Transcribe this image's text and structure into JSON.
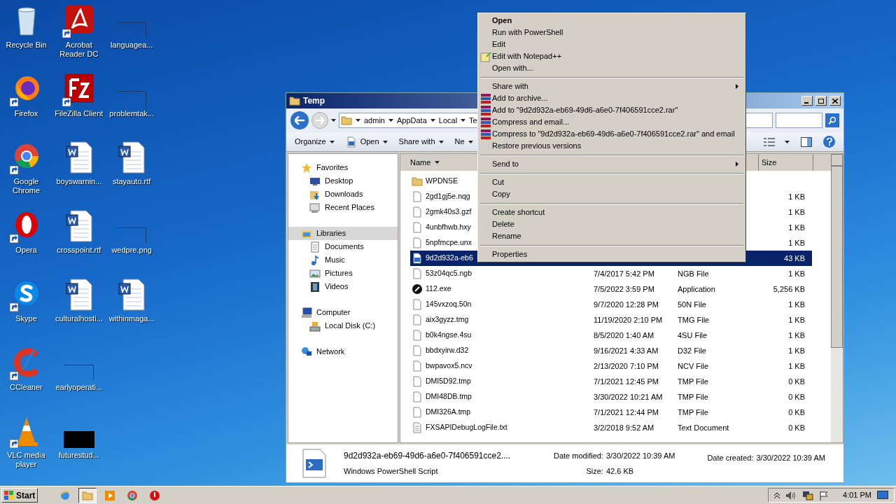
{
  "desktop_icons": [
    {
      "label": "Recycle Bin",
      "kind": "trash",
      "shortcut": false
    },
    {
      "label": "Firefox",
      "kind": "firefox",
      "shortcut": true
    },
    {
      "label": "Google Chrome",
      "kind": "chrome",
      "shortcut": true
    },
    {
      "label": "Opera",
      "kind": "opera",
      "shortcut": true
    },
    {
      "label": "Skype",
      "kind": "skype",
      "shortcut": true
    },
    {
      "label": "CCleaner",
      "kind": "ccleaner",
      "shortcut": true
    },
    {
      "label": "VLC media player",
      "kind": "vlc",
      "shortcut": true
    },
    {
      "label": "Acrobat Reader DC",
      "kind": "acrobat",
      "shortcut": true
    },
    {
      "label": "FileZilla Client",
      "kind": "filezilla",
      "shortcut": true
    },
    {
      "label": "boyswarnin...",
      "kind": "word",
      "shortcut": false
    },
    {
      "label": "crosspoint.rtf",
      "kind": "word",
      "shortcut": false
    },
    {
      "label": "culturalhosti...",
      "kind": "word",
      "shortcut": false
    },
    {
      "label": "earlyoperati...",
      "kind": "blank",
      "shortcut": false
    },
    {
      "label": "futurestud...",
      "kind": "black",
      "shortcut": false
    },
    {
      "label": "languagea...",
      "kind": "blank",
      "shortcut": false
    },
    {
      "label": "problemtak...",
      "kind": "blank",
      "shortcut": false
    },
    {
      "label": "stayauto.rtf",
      "kind": "word",
      "shortcut": false
    },
    {
      "label": "wedpre.png",
      "kind": "blank",
      "shortcut": false
    },
    {
      "label": "withinmaga...",
      "kind": "word",
      "shortcut": false
    }
  ],
  "window": {
    "title": "Temp",
    "breadcrumb": [
      "admin",
      "AppData",
      "Local",
      "Te"
    ],
    "toolbar": [
      {
        "label": "Organize",
        "icon": false
      },
      {
        "label": "Open",
        "icon": true
      },
      {
        "label": "Share with",
        "icon": false
      },
      {
        "label": "Ne",
        "icon": false
      }
    ],
    "nav": [
      {
        "label": "Favorites",
        "kind": "star",
        "selected": false,
        "children": [
          {
            "label": "Desktop",
            "kind": "desktop",
            "selected": false
          },
          {
            "label": "Downloads",
            "kind": "downloads",
            "selected": false
          },
          {
            "label": "Recent Places",
            "kind": "recent",
            "selected": false
          }
        ]
      },
      {
        "label": "Libraries",
        "kind": "library",
        "selected": true,
        "children": [
          {
            "label": "Documents",
            "kind": "documents",
            "selected": false
          },
          {
            "label": "Music",
            "kind": "music",
            "selected": false
          },
          {
            "label": "Pictures",
            "kind": "pictures",
            "selected": false
          },
          {
            "label": "Videos",
            "kind": "videos",
            "selected": false
          }
        ]
      },
      {
        "label": "Computer",
        "kind": "computer",
        "selected": false,
        "children": [
          {
            "label": "Local Disk (C:)",
            "kind": "disk",
            "selected": false
          }
        ]
      },
      {
        "label": "Network",
        "kind": "network",
        "selected": false
      }
    ],
    "columns": {
      "name": "Name",
      "size": "Size"
    },
    "rows": [
      {
        "name": "WPDNSE",
        "kind": "folder",
        "selected": false
      },
      {
        "name": "2gd1gj5e.nqg",
        "kind": "file",
        "size": "1 KB",
        "selected": false
      },
      {
        "name": "2gmk40s3.gzf",
        "kind": "file",
        "size": "1 KB",
        "selected": false
      },
      {
        "name": "4unbfhwb.hxy",
        "kind": "file",
        "size": "1 KB",
        "selected": false
      },
      {
        "name": "5npfmcpe.unx",
        "kind": "file",
        "size": "1 KB",
        "selected": false
      },
      {
        "name": "9d2d932a-eb6",
        "kind": "script",
        "size": "43 KB",
        "selected": true
      },
      {
        "name": "53z04qc5.ngb",
        "kind": "file",
        "date": "7/4/2017 5:42 PM",
        "type": "NGB File",
        "size": "1 KB",
        "selected": false
      },
      {
        "name": "112.exe",
        "kind": "exe",
        "date": "7/5/2022 3:59 PM",
        "type": "Application",
        "size": "5,256 KB",
        "selected": false
      },
      {
        "name": "145vxzoq.50n",
        "kind": "file",
        "date": "9/7/2020 12:28 PM",
        "type": "50N File",
        "size": "1 KB",
        "selected": false
      },
      {
        "name": "aix3gyzz.tmg",
        "kind": "file",
        "date": "11/19/2020 2:10 PM",
        "type": "TMG File",
        "size": "1 KB",
        "selected": false
      },
      {
        "name": "b0k4ngse.4su",
        "kind": "file",
        "date": "8/5/2020 1:40 AM",
        "type": "4SU File",
        "size": "1 KB",
        "selected": false
      },
      {
        "name": "bbdxyirw.d32",
        "kind": "file",
        "date": "9/16/2021 4:33 AM",
        "type": "D32 File",
        "size": "1 KB",
        "selected": false
      },
      {
        "name": "bwpavox5.ncv",
        "kind": "file",
        "date": "2/13/2020 7:10 PM",
        "type": "NCV File",
        "size": "1 KB",
        "selected": false
      },
      {
        "name": "DMI5D92.tmp",
        "kind": "file",
        "date": "7/1/2021 12:45 PM",
        "type": "TMP File",
        "size": "0 KB",
        "selected": false
      },
      {
        "name": "DMI48DB.tmp",
        "kind": "file",
        "date": "3/30/2022 10:21 AM",
        "type": "TMP File",
        "size": "0 KB",
        "selected": false
      },
      {
        "name": "DMI326A.tmp",
        "kind": "file",
        "date": "7/1/2021 12:44 PM",
        "type": "TMP File",
        "size": "0 KB",
        "selected": false
      },
      {
        "name": "FXSAPIDebugLogFile.txt",
        "kind": "text",
        "date": "3/2/2018 9:52 AM",
        "type": "Text Document",
        "size": "0 KB",
        "selected": false
      }
    ],
    "details": {
      "name": "9d2d932a-eb69-49d6-a6e0-7f406591cce2....",
      "type": "Windows PowerShell Script",
      "modified_label": "Date modified:",
      "modified": "3/30/2022 10:39 AM",
      "size_label": "Size:",
      "size": "42.6 KB",
      "created_label": "Date created:",
      "created": "3/30/2022 10:39 AM"
    }
  },
  "context_menu": [
    {
      "kind": "plain",
      "label": "Open",
      "bold": true,
      "submenu": false
    },
    {
      "kind": "plain",
      "label": "Run with PowerShell",
      "bold": false,
      "submenu": false
    },
    {
      "kind": "plain",
      "label": "Edit",
      "bold": false,
      "submenu": false
    },
    {
      "kind": "notepad",
      "label": "Edit with Notepad++",
      "bold": false,
      "submenu": false
    },
    {
      "kind": "plain",
      "label": "Open with...",
      "bold": false,
      "submenu": false
    },
    {
      "kind": "separator"
    },
    {
      "kind": "plain",
      "label": "Share with",
      "bold": false,
      "submenu": true
    },
    {
      "kind": "archive",
      "label": "Add to archive...",
      "bold": false,
      "submenu": false
    },
    {
      "kind": "archive",
      "label": "Add to \"9d2d932a-eb69-49d6-a6e0-7f406591cce2.rar\"",
      "bold": false,
      "submenu": false
    },
    {
      "kind": "archive",
      "label": "Compress and email...",
      "bold": false,
      "submenu": false
    },
    {
      "kind": "archive",
      "label": "Compress to \"9d2d932a-eb69-49d6-a6e0-7f406591cce2.rar\" and email",
      "bold": false,
      "submenu": false
    },
    {
      "kind": "plain",
      "label": "Restore previous versions",
      "bold": false,
      "submenu": false
    },
    {
      "kind": "separator"
    },
    {
      "kind": "plain",
      "label": "Send to",
      "bold": false,
      "submenu": true
    },
    {
      "kind": "separator"
    },
    {
      "kind": "plain",
      "label": "Cut",
      "bold": false,
      "submenu": false
    },
    {
      "kind": "plain",
      "label": "Copy",
      "bold": false,
      "submenu": false
    },
    {
      "kind": "separator"
    },
    {
      "kind": "plain",
      "label": "Create shortcut",
      "bold": false,
      "submenu": false
    },
    {
      "kind": "plain",
      "label": "Delete",
      "bold": false,
      "submenu": false
    },
    {
      "kind": "plain",
      "label": "Rename",
      "bold": false,
      "submenu": false
    },
    {
      "kind": "separator"
    },
    {
      "kind": "plain",
      "label": "Properties",
      "bold": false,
      "submenu": false
    }
  ],
  "taskbar": {
    "start": "Start",
    "apps": [
      {
        "kind": "ie",
        "active": false
      },
      {
        "kind": "explorer",
        "active": true
      },
      {
        "kind": "media",
        "active": false
      },
      {
        "kind": "chrome",
        "active": false
      },
      {
        "kind": "red",
        "active": false
      }
    ],
    "clock": "4:01 PM"
  }
}
